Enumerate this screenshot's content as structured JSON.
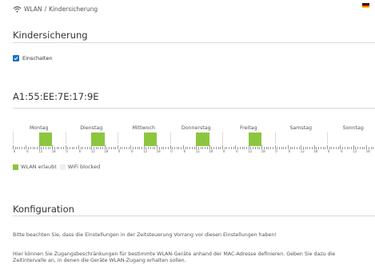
{
  "breadcrumb": {
    "section": "WLAN",
    "separator": "/",
    "page": "Kindersicherung"
  },
  "flag": {
    "language": "de",
    "colors": [
      "#000000",
      "#dd0000",
      "#ffce00"
    ]
  },
  "parental": {
    "title": "Kindersicherung",
    "enable_label": "Einschalten",
    "enabled": true
  },
  "device": {
    "mac": "A1:55:EE:7E:17:9E"
  },
  "schedule": {
    "days": [
      {
        "name": "Montag",
        "allowed": [
          [
            12,
            18
          ]
        ]
      },
      {
        "name": "Dienstag",
        "allowed": [
          [
            12,
            18
          ]
        ]
      },
      {
        "name": "Mittwoch",
        "allowed": [
          [
            12,
            18
          ]
        ]
      },
      {
        "name": "Donnerstag",
        "allowed": [
          [
            12,
            18
          ]
        ]
      },
      {
        "name": "Freitag",
        "allowed": [
          [
            12,
            18
          ]
        ]
      },
      {
        "name": "Samstag",
        "allowed": []
      },
      {
        "name": "Sonntag",
        "allowed": []
      }
    ],
    "hour_labels": [
      "0",
      "6",
      "12",
      "18"
    ]
  },
  "legend": {
    "allowed": "WLAN erlaubt",
    "blocked": "WiFi blocked"
  },
  "colors": {
    "allowed": "#8cc63f",
    "blocked": "#eeeeee",
    "accent": "#1a73c8"
  },
  "config": {
    "title": "Konfiguration",
    "note": "Bitte beachten Sie, dass die Einstellungen in der Zeitsteuerung Vorrang vor diesen Einstellungen haben!",
    "description_line1": "Hier können Sie Zugangsbeschränkungen für bestimmte WLAN-Geräte anhand der MAC-Adresse definieren. Geben Sie dazu die",
    "description_line2": "Zeitintervalle an, in denen die Geräte WLAN-Zugang erhalten sollen."
  }
}
